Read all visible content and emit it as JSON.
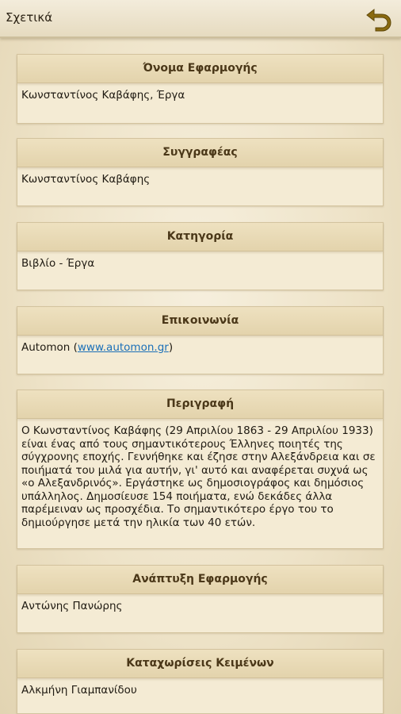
{
  "app_bar": {
    "title": "Σχετικά",
    "back_icon": "undo-arrow-icon",
    "back_icon_color": "#8a6a10"
  },
  "sections": {
    "app_name": {
      "heading": "Όνομα Εφαρμογής",
      "value": "Κωνσταντίνος Καβάφης, Έργα"
    },
    "author": {
      "heading": "Συγγραφέας",
      "value": "Κωνσταντίνος Καβάφης"
    },
    "category": {
      "heading": "Κατηγορία",
      "value": "Βιβλίο - Έργα"
    },
    "contact": {
      "heading": "Επικοινωνία",
      "company": "Automon",
      "open_paren": " (",
      "link": "www.automon.gr",
      "close_paren": ")"
    },
    "description": {
      "heading": "Περιγραφή",
      "value": "Ο Κωνσταντίνος Καβάφης (29 Απριλίου 1863 - 29 Απριλίου 1933) είναι ένας από τους σημαντικότερους Έλληνες ποιητές της σύγχρονης εποχής. Γεννήθηκε και έζησε στην Αλεξάνδρεια και σε ποιήματά του μιλά για αυτήν, γι' αυτό και αναφέρεται συχνά ως «ο Αλεξανδρινός». Εργάστηκε ως δημοσιογράφος και δημόσιος υπάλληλος. Δημοσίευσε 154 ποιήματα, ενώ δεκάδες άλλα παρέμειναν ως προσχέδια. Το σημαντικότερο έργο του το δημιούργησε μετά την ηλικία των 40 ετών."
    },
    "development": {
      "heading": "Ανάπτυξη Εφαρμογής",
      "value": "Αντώνης Πανώρης"
    },
    "text_entries": {
      "heading": "Καταχωρίσεις Κειμένων",
      "value": "Αλκμήνη Γιαμπανίδου"
    }
  }
}
